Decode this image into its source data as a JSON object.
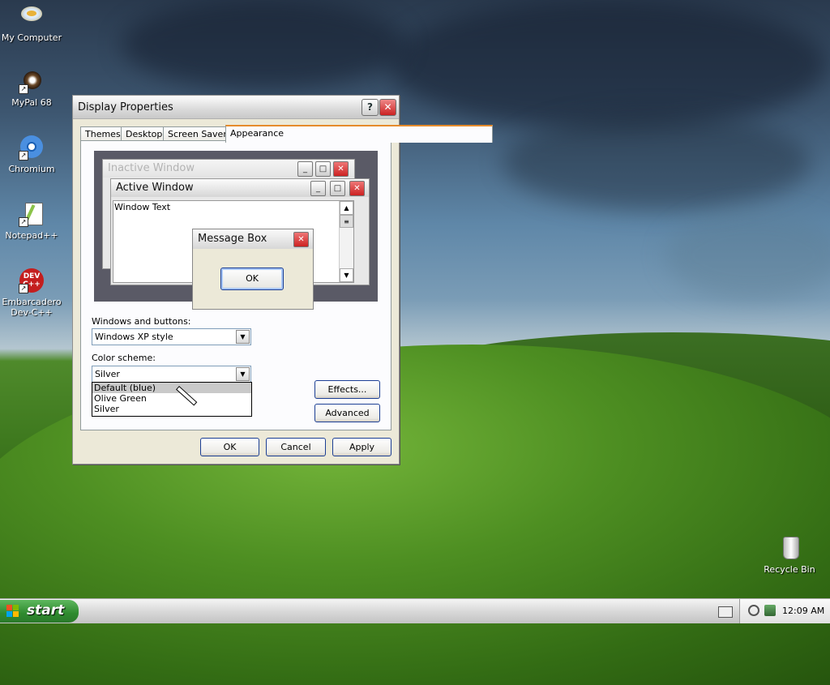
{
  "desktop": {
    "icons": [
      {
        "label": "My Computer",
        "icon": "my-computer-icon"
      },
      {
        "label": "MyPal 68",
        "icon": "mypal-icon"
      },
      {
        "label": "Chromium",
        "icon": "chromium-icon"
      },
      {
        "label": "Notepad++",
        "icon": "notepadpp-icon"
      },
      {
        "label": "Embarcadero Dev-C++",
        "icon": "devcpp-icon",
        "badge": "DEV C++"
      },
      {
        "label": "Recycle Bin",
        "icon": "recycle-bin-icon"
      }
    ]
  },
  "dialog": {
    "title": "Display Properties",
    "help": "?",
    "close": "X",
    "tabs": [
      "Themes",
      "Desktop",
      "Screen Saver",
      "Appearance"
    ],
    "active_tab": "Appearance",
    "preview": {
      "inactive_title": "Inactive Window",
      "active_title": "Active Window",
      "window_text": "Window Text",
      "msgbox_title": "Message Box",
      "ok": "OK"
    },
    "windows_buttons_label": "Windows and buttons:",
    "windows_buttons_value": "Windows XP style",
    "color_scheme_label": "Color scheme:",
    "color_scheme_value": "Silver",
    "color_scheme_options": [
      "Default (blue)",
      "Olive Green",
      "Silver"
    ],
    "highlighted_option": "Default (blue)",
    "effects": "Effects...",
    "advanced": "Advanced",
    "ok": "OK",
    "cancel": "Cancel",
    "apply": "Apply"
  },
  "taskbar": {
    "start": "start",
    "clock": "12:09 AM"
  },
  "colors": {
    "start_green": "#2e8a2e",
    "close_red": "#c22",
    "tab_accent": "#e68b2c",
    "button_border": "#1c3f94"
  }
}
